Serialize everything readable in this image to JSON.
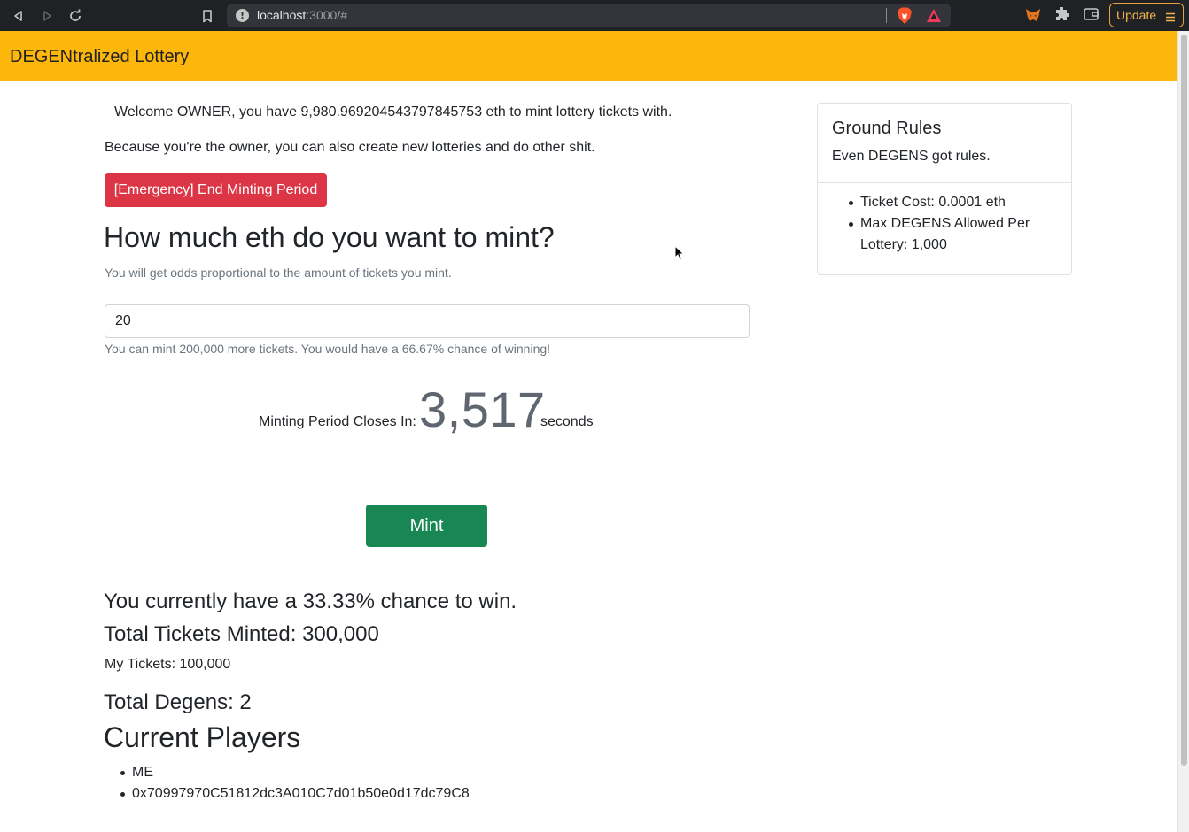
{
  "browser": {
    "url_host": "localhost",
    "url_rest": ":3000/#",
    "update_label": "Update",
    "icons": [
      "back-icon",
      "forward-icon",
      "reload-icon",
      "bookmark-icon",
      "site-info-icon",
      "brave-shield-icon",
      "brave-rewards-icon",
      "metamask-icon",
      "extensions-icon",
      "wallet-icon",
      "menu-icon"
    ]
  },
  "app": {
    "title": "DEGENtralized Lottery",
    "accent_color": "#fcb70a"
  },
  "main": {
    "welcome": "Welcome OWNER, you have 9,980.969204543797845753 eth to mint lottery tickets with.",
    "owner_note": "Because you're the owner, you can also create new lotteries and do other shit.",
    "emergency_button": "[Emergency] End Minting Period",
    "mint_heading": "How much eth do you want to mint?",
    "odds_note": "You will get odds proportional to the amount of tickets you mint.",
    "amount_value": "20",
    "mint_info": "You can mint 200,000 more tickets. You would have a 66.67% chance of winning!",
    "countdown_label": "Minting Period Closes In:",
    "countdown_value": "3,517",
    "countdown_unit": "seconds",
    "mint_button": "Mint",
    "chance_line": "You currently have a 33.33% chance to win.",
    "total_tickets": "Total Tickets Minted: 300,000",
    "my_tickets": "My Tickets: 100,000",
    "total_degens": "Total Degens: 2",
    "players_heading": "Current Players",
    "players": [
      "ME",
      "0x70997970C51812dc3A010C7d01b50e0d17dc79C8"
    ]
  },
  "rules": {
    "title": "Ground Rules",
    "subtitle": "Even DEGENS got rules.",
    "items": [
      "Ticket Cost: 0.0001 eth",
      "Max DEGENS Allowed Per Lottery: 1,000"
    ]
  }
}
